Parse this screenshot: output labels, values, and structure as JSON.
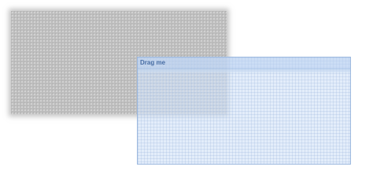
{
  "gray_panel": {
    "fill_color": "#bdbdbd"
  },
  "drag_window": {
    "title": "Drag me",
    "title_color": "#4a6fa5",
    "fill_color": "#d5e5f7",
    "border_color": "#96b4dc"
  }
}
